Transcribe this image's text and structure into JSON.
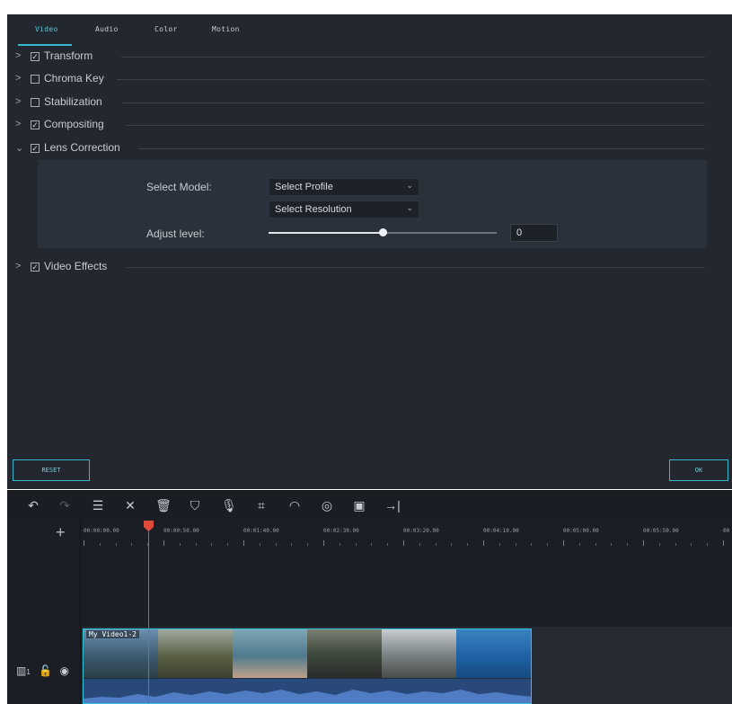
{
  "tabs": [
    "Video",
    "Audio",
    "Color",
    "Motion"
  ],
  "sections": [
    {
      "label": "Transform",
      "chevron": ">",
      "checked": true
    },
    {
      "label": "Chroma Key",
      "chevron": ">",
      "checked": false
    },
    {
      "label": "Stabilization",
      "chevron": ">",
      "checked": false
    },
    {
      "label": "Compositing",
      "chevron": ">",
      "checked": true
    },
    {
      "label": "Lens Correction",
      "chevron": "⌄",
      "checked": true
    },
    {
      "label": "Video Effects",
      "chevron": ">",
      "checked": true
    }
  ],
  "lens": {
    "select_model_label": "Select Model:",
    "profile_value": "Select Profile",
    "resolution_value": "Select Resolution",
    "adjust_label": "Adjust level:",
    "adjust_value": "0",
    "slider_fraction": 0.5
  },
  "buttons": {
    "reset": "RESET",
    "ok": "OK"
  },
  "toolbar": {
    "tools": [
      "undo-icon",
      "redo-icon",
      "adjust-icon",
      "cut-icon",
      "delete-icon",
      "marker-icon",
      "record-voice-icon",
      "crop-icon",
      "speed-icon",
      "color-icon",
      "screen-icon",
      "export-icon"
    ]
  },
  "timeline": {
    "ticks": [
      "00:00:00.00",
      "00:00:50.00",
      "00:01:40.00",
      "00:02:30.00",
      "00:03:20.00",
      "00:04:10.00",
      "00:05:00.00",
      "00:05:50.00",
      "00"
    ],
    "clip_title": "My Video1-2",
    "track_number": "1"
  },
  "colors": {
    "accent": "#38b7cf",
    "playhead": "#e04b3b",
    "panel": "#232830"
  }
}
